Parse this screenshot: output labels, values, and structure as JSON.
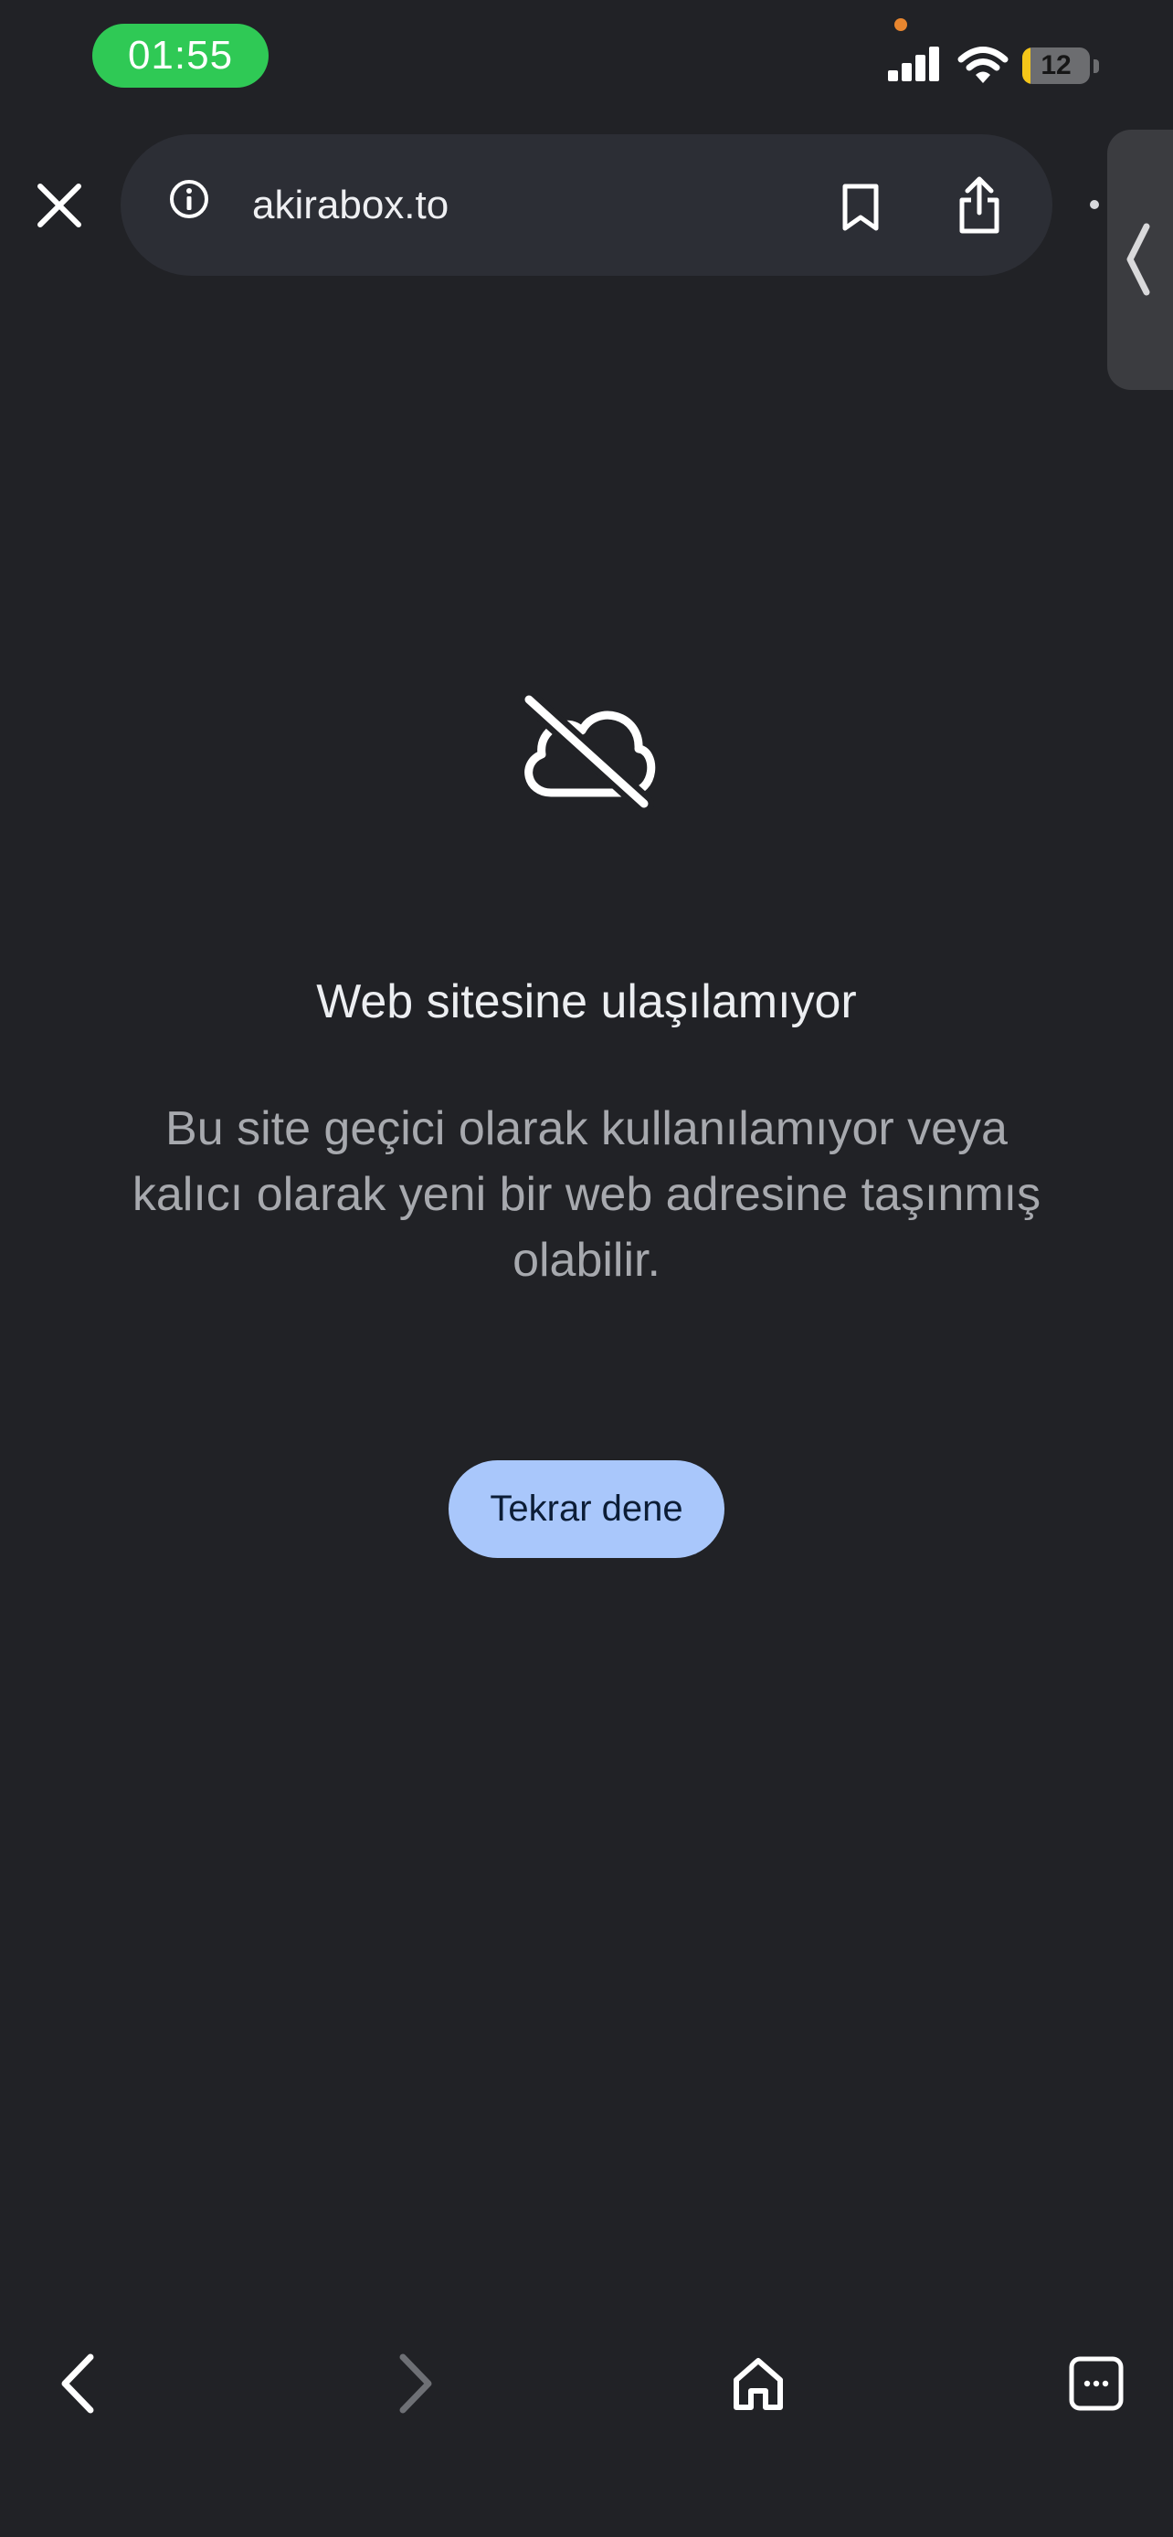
{
  "status_bar": {
    "time": "01:55",
    "battery_level": "12",
    "battery_fraction": 0.12,
    "icons": [
      "privacy-indicator-dot",
      "cellular-signal-icon",
      "wifi-icon",
      "battery-icon"
    ]
  },
  "toolbar": {
    "url": "akirabox.to",
    "icons": [
      "close-icon",
      "info-icon",
      "bookmark-icon",
      "share-icon",
      "more-icon",
      "chevron-left-icon"
    ]
  },
  "error": {
    "icon": "cloud-off-icon",
    "title": "Web sitesine ulaşılamıyor",
    "message": "Bu site geçici olarak kullanılamıyor veya kalıcı olarak yeni bir web adresine taşınmış olabilir.",
    "retry_label": "Tekrar dene"
  },
  "bottom_bar": {
    "icons": [
      "back-icon",
      "forward-icon",
      "home-icon",
      "tabs-icon"
    ]
  },
  "colors": {
    "background": "#212226",
    "url_bar": "#2c2e35",
    "time_pill": "#2fc955",
    "battery_low": "#f5c619",
    "retry_button": "#a9c7fb",
    "title_text": "#eceef1",
    "message_text": "#a7a9ae"
  }
}
